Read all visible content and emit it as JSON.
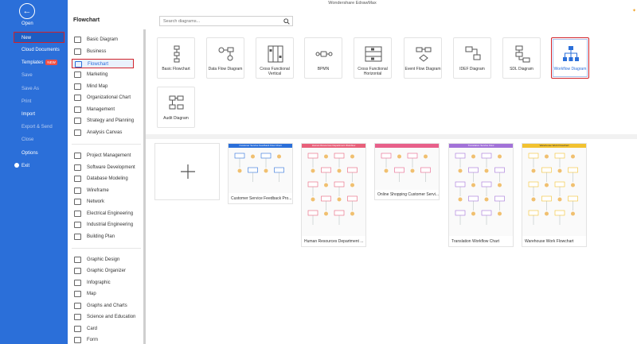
{
  "window": {
    "title": "Wondershare EdrawMax"
  },
  "nav": {
    "back_icon": "back-arrow-icon",
    "items": [
      {
        "label": "Open",
        "muted": false
      },
      {
        "label": "New",
        "muted": false,
        "selected": true
      },
      {
        "label": "Cloud Documents",
        "muted": false
      },
      {
        "label": "Templates",
        "muted": false,
        "badge": "NEW"
      },
      {
        "label": "Save",
        "muted": true
      },
      {
        "label": "Save As",
        "muted": true
      },
      {
        "label": "Print",
        "muted": true
      },
      {
        "label": "Import",
        "muted": false
      },
      {
        "label": "Export & Send",
        "muted": true
      },
      {
        "label": "Close",
        "muted": true
      },
      {
        "label": "Options",
        "muted": false
      },
      {
        "label": "Exit",
        "muted": false
      }
    ]
  },
  "header": {
    "section_title": "Flowchart",
    "search_placeholder": "Search diagrams..."
  },
  "categories": [
    {
      "label": "Basic Diagram",
      "icon": "basic-diagram-icon"
    },
    {
      "label": "Business",
      "icon": "business-icon"
    },
    {
      "label": "Flowchart",
      "icon": "flowchart-icon",
      "active": true
    },
    {
      "label": "Marketing",
      "icon": "marketing-icon"
    },
    {
      "label": "Mind Map",
      "icon": "mind-map-icon"
    },
    {
      "label": "Organizational Chart",
      "icon": "org-chart-icon"
    },
    {
      "label": "Management",
      "icon": "management-icon"
    },
    {
      "label": "Strategy and Planning",
      "icon": "strategy-icon"
    },
    {
      "label": "Analysis Canvas",
      "icon": "analysis-canvas-icon"
    },
    {
      "label": "Project Management",
      "icon": "project-management-icon"
    },
    {
      "label": "Software Development",
      "icon": "software-dev-icon"
    },
    {
      "label": "Database Modeling",
      "icon": "database-icon"
    },
    {
      "label": "Wireframe",
      "icon": "wireframe-icon"
    },
    {
      "label": "Network",
      "icon": "network-icon"
    },
    {
      "label": "Electrical Engineering",
      "icon": "electrical-icon"
    },
    {
      "label": "Industrial Engineering",
      "icon": "industrial-icon"
    },
    {
      "label": "Building Plan",
      "icon": "building-plan-icon"
    },
    {
      "label": "Graphic Design",
      "icon": "graphic-design-icon"
    },
    {
      "label": "Graphic Organizer",
      "icon": "graphic-organizer-icon"
    },
    {
      "label": "Infographic",
      "icon": "infographic-icon"
    },
    {
      "label": "Map",
      "icon": "map-icon"
    },
    {
      "label": "Graphs and Charts",
      "icon": "graphs-icon"
    },
    {
      "label": "Science and Education",
      "icon": "science-icon"
    },
    {
      "label": "Card",
      "icon": "card-icon"
    },
    {
      "label": "Form",
      "icon": "form-icon"
    }
  ],
  "diagram_types": [
    {
      "label": "Basic Flowchart",
      "icon": "basic-flowchart-icon"
    },
    {
      "label": "Data Flow Diagram",
      "icon": "data-flow-icon"
    },
    {
      "label": "Cross Functional Vertical",
      "icon": "cross-vertical-icon"
    },
    {
      "label": "BPMN",
      "icon": "bpmn-icon"
    },
    {
      "label": "Cross Functional Horizontal",
      "icon": "cross-horizontal-icon"
    },
    {
      "label": "Event Flow Diagram",
      "icon": "event-flow-icon"
    },
    {
      "label": "IDEF Diagram",
      "icon": "idef-icon"
    },
    {
      "label": "SDL Diagram",
      "icon": "sdl-icon"
    },
    {
      "label": "Workflow Diagram",
      "icon": "workflow-icon",
      "selected": true
    },
    {
      "label": "Audit Diagram",
      "icon": "audit-icon"
    }
  ],
  "templates": [
    {
      "label": "Customer Service Feedback Pro...",
      "header": "Customer Service Feedback Flow Chart",
      "accent": "#2b6fd9"
    },
    {
      "label": "Human Resources Department ...",
      "header": "Human Resources Department Workflow",
      "accent": "#e8607a"
    },
    {
      "label": "Online Shopping Customer Servi...",
      "header": "",
      "accent": "#e8608a"
    },
    {
      "label": "Translation Workflow Chart",
      "header": "Translation Service Flow",
      "accent": "#a272d8"
    },
    {
      "label": "Warehouse Work Flowchart",
      "header": "Warehouse Work Flowchart",
      "accent": "#f2c230"
    }
  ],
  "colors": {
    "nav_bg": "#2b6fd9",
    "highlight": "#d2232a",
    "accent": "#2b6fd9"
  }
}
